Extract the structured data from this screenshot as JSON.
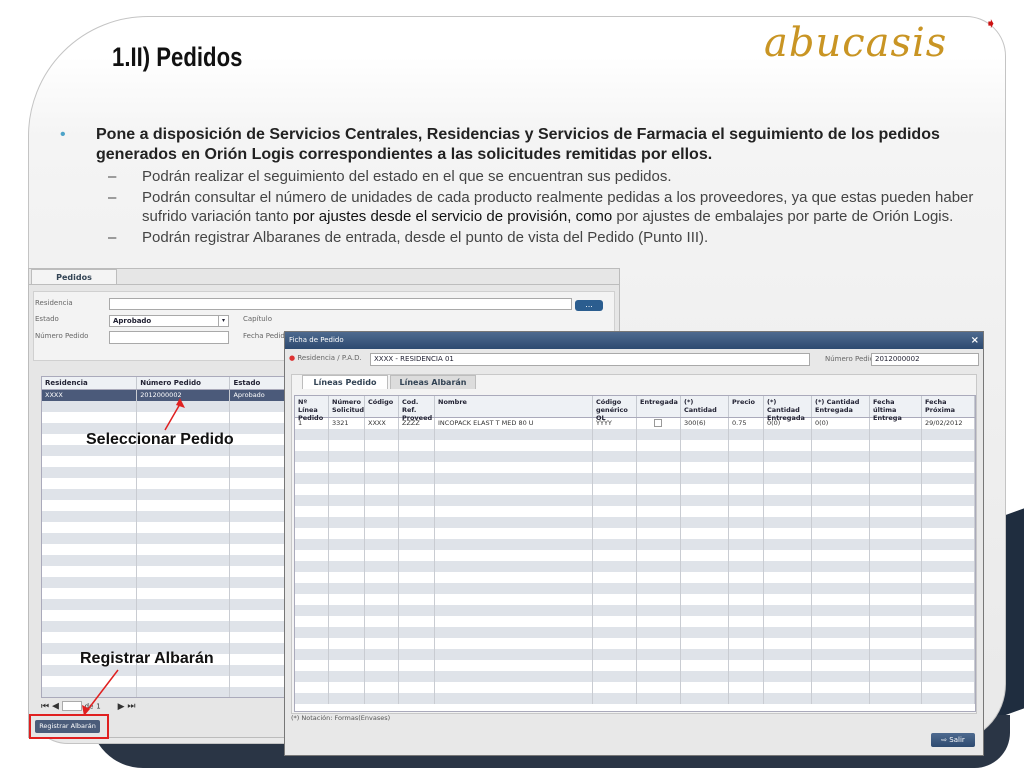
{
  "slide": {
    "title": "1.II) Pedidos",
    "logo": "abucasis",
    "bullet_main": "Pone a disposición de Servicios Centrales, Residencias y Servicios de Farmacia el seguimiento de los pedidos generados en Orión Logis correspondientes a las solicitudes remitidas por ellos.",
    "bullet_dot": "•",
    "sub_dash": "–",
    "sub1": "Podrán realizar el seguimiento del estado en el que se encuentran sus pedidos.",
    "sub2_a": "Podrán consultar el número de unidades de cada producto realmente pedidas a los proveedores, ya que estas pueden haber sufrido variación tanto ",
    "sub2_b": "por ajustes desde el servicio de provisión, como",
    "sub2_c": " por ajustes de embalajes por parte de Orión Logis.",
    "sub3": "Podrán registrar Albaranes de entrada, desde el punto de vista del Pedido (Punto III).",
    "callout_select": "Seleccionar Pedido",
    "callout_register": "Registrar Albarán",
    "colors": {
      "logo": "#c99524",
      "bullet": "#4da3c8",
      "highlight": "#e02020",
      "header_bar": "#2d4a70"
    }
  },
  "pedidos": {
    "tab_label": "Pedidos",
    "residencia_label": "Residencia",
    "estado_label": "Estado",
    "estado_value": "Aprobado",
    "capitulo_label": "Capítulo",
    "numero_label": "Número Pedido",
    "fecha_label": "Fecha Pedido",
    "dots_button": "...",
    "columns": [
      "Residencia",
      "Número Pedido",
      "Estado"
    ],
    "rows": [
      [
        "XXXX",
        "2012000002",
        "Aprobado"
      ]
    ],
    "pager_of": "de",
    "pager_total": "1",
    "register_button": "Registrar Albarán"
  },
  "ficha": {
    "title": "Ficha de Pedido",
    "close": "×",
    "residencia_label": "Residencia / P.A.D.",
    "residencia_value": "XXXX - RESIDENCIA 01",
    "numero_label": "Número Pedido",
    "numero_value": "2012000002",
    "tabs": [
      "Líneas Pedido",
      "Líneas Albarán"
    ],
    "columns": [
      "Nº Línea Pedido",
      "Número Solicitud",
      "Código",
      "Cod. Ref. Proveed",
      "Nombre",
      "Código genérico OL",
      "Entregada",
      "(*) Cantidad",
      "Precio",
      "(*) Cantidad Entregada",
      "(*) Cantidad Entregada",
      "Fecha última Entrega",
      "Fecha Próxima"
    ],
    "row": [
      "1",
      "3321",
      "XXXX",
      "ZZZZ",
      "INCOPACK ELAST T MED 80 U",
      "YYYY",
      "",
      "300(6)",
      "0.75",
      "0(0)",
      "0(0)",
      "",
      "29/02/2012"
    ],
    "note": "(*) Notación: Formas(Envases)",
    "salir": "Salir"
  }
}
